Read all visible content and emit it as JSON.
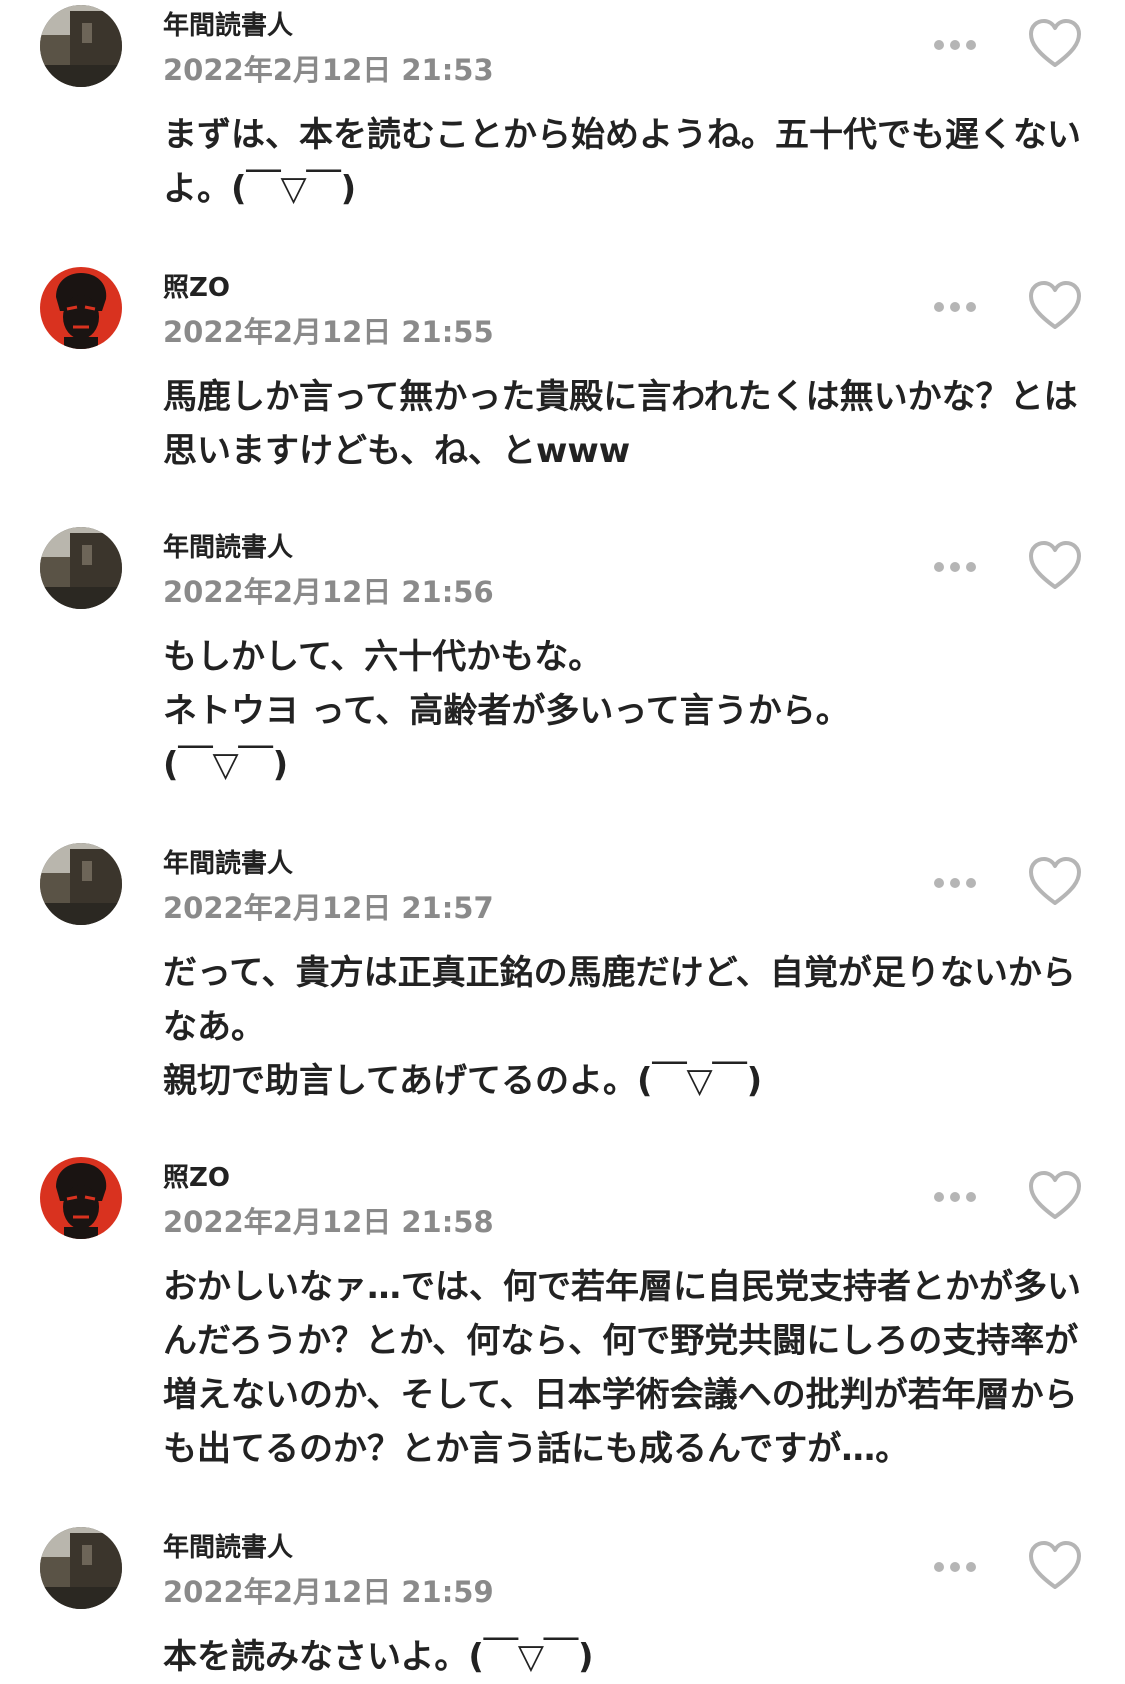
{
  "comments": [
    {
      "user": "年間読書人",
      "timestamp": "2022年2月12日 21:53",
      "avatar": "street-photo-avatar",
      "text": "まずは、本を読むことから始めようね。五十代でも遅くない\nよ。(￣▽￣)"
    },
    {
      "user": "照ZO",
      "timestamp": "2022年2月12日 21:55",
      "avatar": "red-portrait-avatar",
      "text": "馬鹿しか言って無かった貴殿に言われたくは無いかな？とは\n思いますけども、ね、とwww"
    },
    {
      "user": "年間読書人",
      "timestamp": "2022年2月12日 21:56",
      "avatar": "street-photo-avatar",
      "text": "もしかして、六十代かもな。\nネトウヨ って、高齢者が多いって言うから。\n(￣▽￣)"
    },
    {
      "user": "年間読書人",
      "timestamp": "2022年2月12日 21:57",
      "avatar": "street-photo-avatar",
      "text": "だって、貴方は正真正銘の馬鹿だけど、自覚が足りないから\nなあ。\n親切で助言してあげてるのよ。(￣▽￣)"
    },
    {
      "user": "照ZO",
      "timestamp": "2022年2月12日 21:58",
      "avatar": "red-portrait-avatar",
      "text": "おかしいなァ…では、何で若年層に自民党支持者とかが多い\nんだろうか？とか、何なら、何で野党共闘にしろの支持率が\n増えないのか、そして、日本学術会議への批判が若年層から\nも出てるのか？とか言う話にも成るんですが…。"
    },
    {
      "user": "年間読書人",
      "timestamp": "2022年2月12日 21:59",
      "avatar": "street-photo-avatar",
      "text": "本を読みなさいよ。(￣▽￣)"
    }
  ],
  "icons": {
    "more": "more-horizontal-icon",
    "like": "heart-outline-icon"
  },
  "colors": {
    "text": "#222222",
    "timestamp": "#8a8a8a",
    "icon": "#b5b5b5",
    "avatar_red": "#d9321f"
  }
}
